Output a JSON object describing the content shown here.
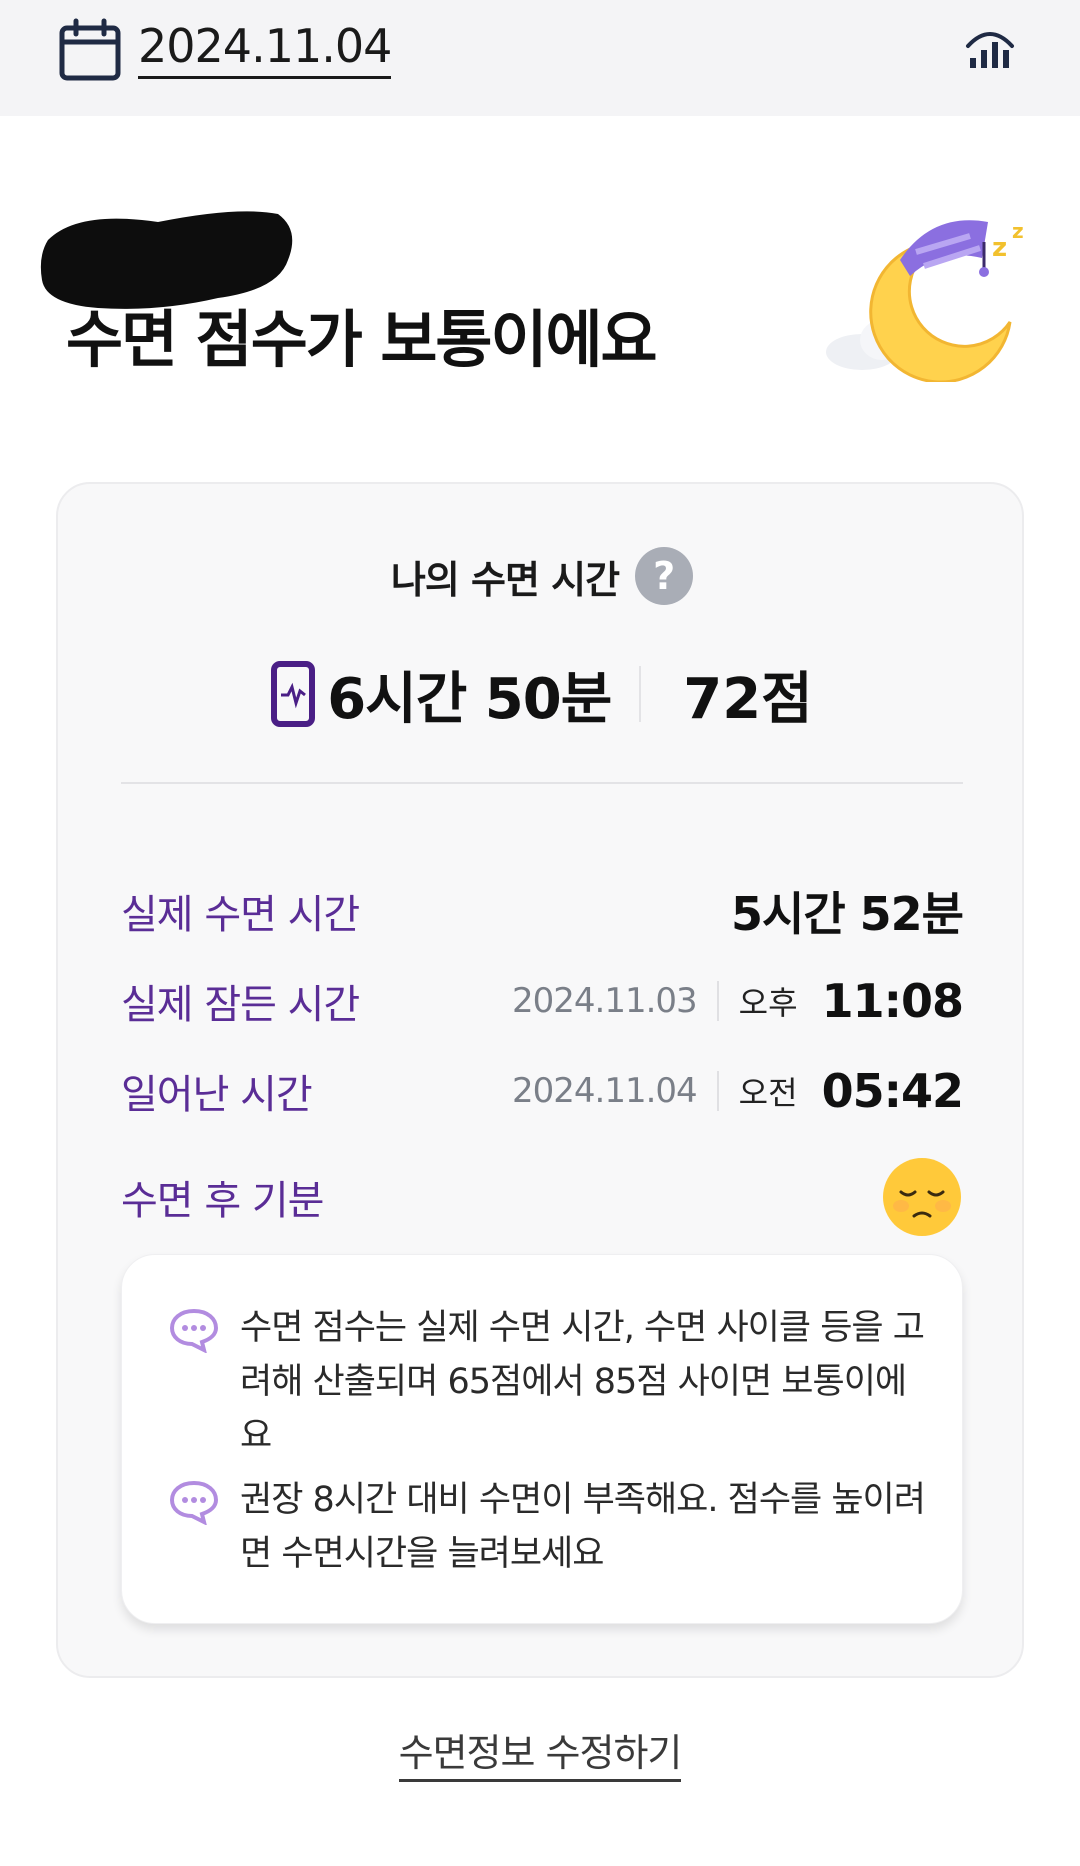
{
  "header": {
    "date": "2024.11.04",
    "calendar_icon": "calendar-icon",
    "stats_icon": "bar-chart-icon"
  },
  "headline": "수면 점수가 보통이에요",
  "card": {
    "title": "나의 수면 시간",
    "help_icon": "question-mark-icon",
    "help_glyph": "?",
    "total_time": "6시간 50분",
    "score": "72점",
    "rows": [
      {
        "label": "실제 수면 시간",
        "value": "5시간 52분"
      },
      {
        "label": "실제 잠든 시간",
        "date": "2024.11.03",
        "ampm": "오후",
        "time": "11:08"
      },
      {
        "label": "일어난 시간",
        "date": "2024.11.04",
        "ampm": "오전",
        "time": "05:42"
      },
      {
        "label": "수면 후 기분",
        "icon": "sleepy-face-icon"
      }
    ],
    "info": [
      "수면 점수는 실제 수면 시간, 수면 사이클 등을 고려해 산출되며 65점에서 85점 사이면 보통이에요",
      "권장 8시간 대비 수면이 부족해요. 점수를 높이려면 수면시간을 늘려보세요"
    ]
  },
  "edit_link": "수면정보 수정하기",
  "colors": {
    "accent_purple": "#5a2d96",
    "phone_icon": "#4a1f86",
    "chat_icon": "#b28ce0",
    "moon": "#ffd24d",
    "nightcap": "#8b6fe0"
  }
}
